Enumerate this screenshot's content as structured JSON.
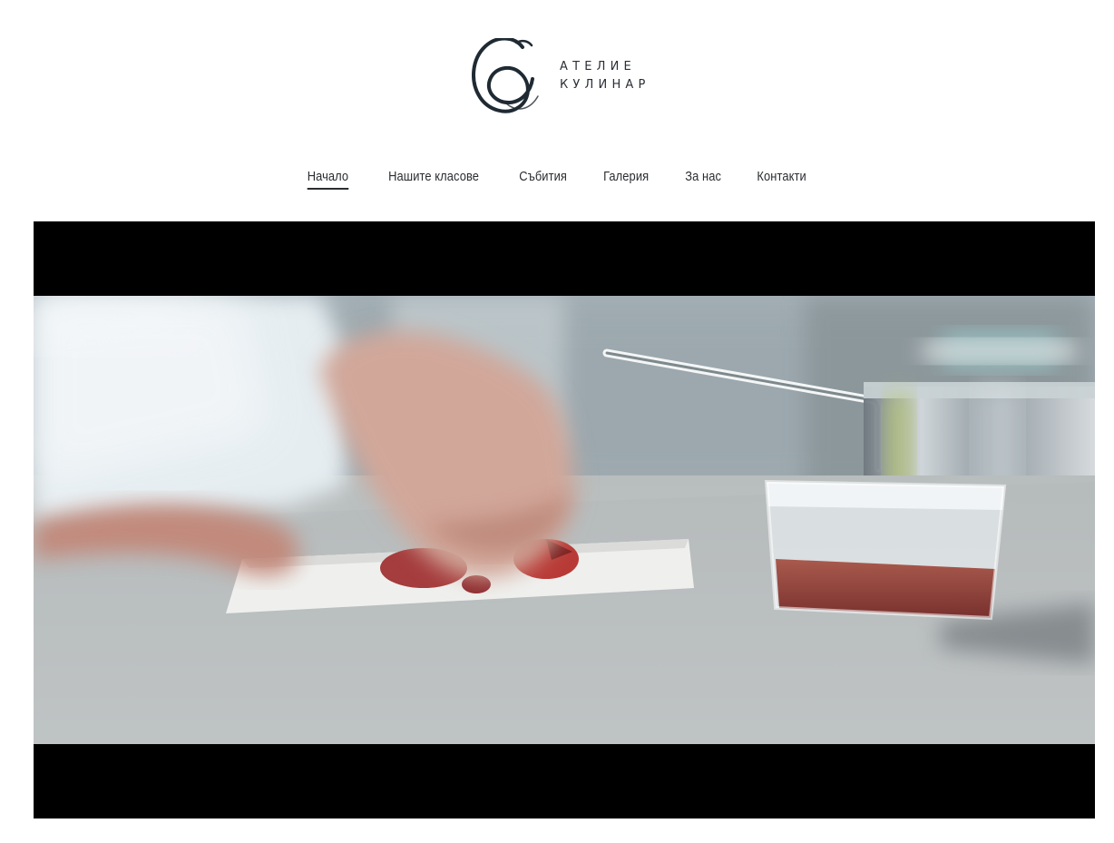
{
  "brand": {
    "line1": "АТЕЛИЕ",
    "line2": "КУЛИНАР",
    "color": "#1f2a33"
  },
  "navigation": [
    {
      "label": "Начало",
      "active": true
    },
    {
      "label": "Нашите класове",
      "active": false
    },
    {
      "label": "Събития",
      "active": false
    },
    {
      "label": "Галерия",
      "active": false
    },
    {
      "label": "За нас",
      "active": false
    },
    {
      "label": "Контакти",
      "active": false
    }
  ]
}
